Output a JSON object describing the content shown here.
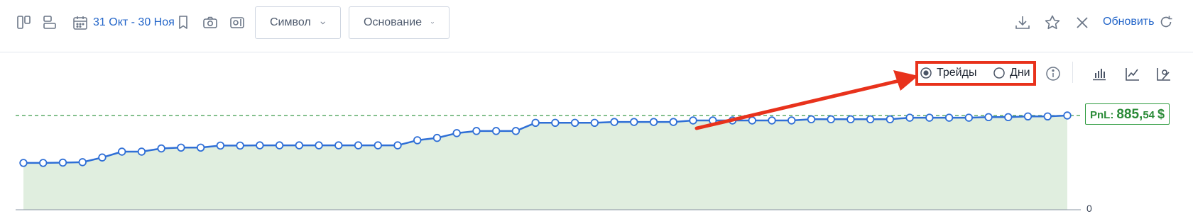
{
  "toolbar": {
    "date_range": "31 Окт - 30 Ноя",
    "symbol_label": "Символ",
    "basis_label": "Основание",
    "refresh_label": "Обновить"
  },
  "controls": {
    "trades_label": "Трейды",
    "days_label": "Дни",
    "selected": "trades"
  },
  "pnl": {
    "label": "PnL:",
    "integer_part": "885,",
    "decimal_part": "54",
    "currency": "$"
  },
  "colors": {
    "accent": "#2466c9",
    "line": "#2f6fd6",
    "area": "#e0eedf",
    "pnl": "#2a8a37",
    "highlight": "#e8321c"
  },
  "chart_data": {
    "type": "area",
    "y_tick_labels": [
      "0"
    ],
    "ylim": [
      0,
      885.54
    ],
    "series": [
      {
        "values": [
          440,
          440,
          443,
          447,
          491,
          546,
          546,
          576,
          584,
          584,
          603,
          603,
          605,
          605,
          605,
          605,
          605,
          605,
          605,
          605,
          653,
          675,
          720,
          740,
          740,
          740,
          817,
          817,
          817,
          817,
          825,
          825,
          825,
          825,
          839,
          839,
          839,
          839,
          839,
          839,
          850,
          850,
          850,
          850,
          850,
          865,
          865,
          865,
          865,
          870,
          870,
          877,
          877,
          885.54
        ]
      }
    ],
    "reference_line": 885.54,
    "grid": false,
    "annotations": [
      "PnL: 885,54 $"
    ]
  }
}
